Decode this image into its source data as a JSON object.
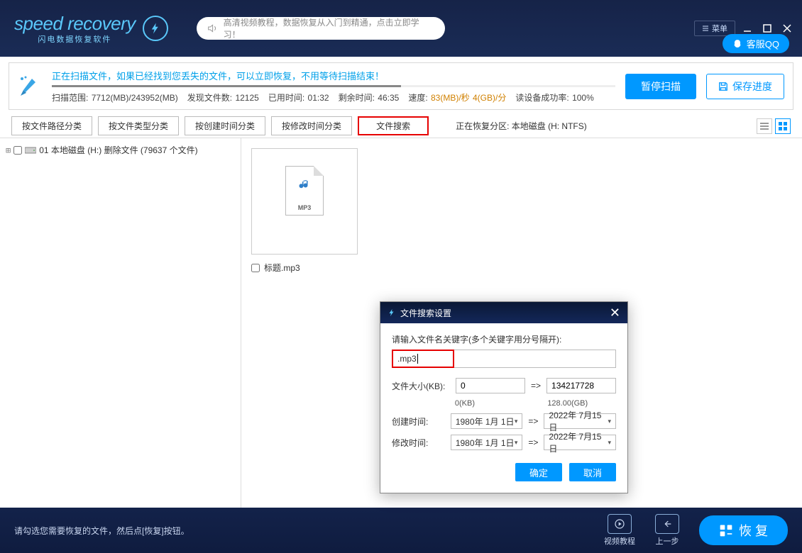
{
  "header": {
    "logo_main": "speed recovery",
    "logo_sub": "闪电数据恢复软件",
    "tutorial": "高清视频教程，数据恢复从入门到精通，点击立即学习！",
    "menu": "菜单",
    "qq": "客服QQ"
  },
  "scan": {
    "status_line": "正在扫描文件，如果已经找到您丢失的文件，可以立即恢复，不用等待扫描结束！",
    "range_label": "扫描范围:",
    "range_value": "7712(MB)/243952(MB)",
    "found_label": "发现文件数:",
    "found_value": "12125",
    "elapsed_label": "已用时间:",
    "elapsed_value": "01:32",
    "remain_label": "剩余时间:",
    "remain_value": "46:35",
    "speed_label": "速度:",
    "speed_value": "83(MB)/秒  4(GB)/分",
    "success_label": "读设备成功率:",
    "success_value": "100%",
    "pause": "暂停扫描",
    "save": "保存进度"
  },
  "tabs": {
    "t1": "按文件路径分类",
    "t2": "按文件类型分类",
    "t3": "按创建时间分类",
    "t4": "按修改时间分类",
    "t5": "文件搜索",
    "partition": "正在恢复分区: 本地磁盘 (H: NTFS)"
  },
  "tree": {
    "item1": "01 本地磁盘 (H:) 删除文件  (79637 个文件)"
  },
  "file": {
    "badge": "MP3",
    "name": "标题.mp3"
  },
  "dialog": {
    "title": "文件搜索设置",
    "kw_label": "请输入文件名关键字(多个关键字用分号隔开):",
    "kw_value": ".mp3",
    "size_label": "文件大小(KB):",
    "size_from": "0",
    "size_to": "134217728",
    "size_from_hint": "0(KB)",
    "size_to_hint": "128.00(GB)",
    "create_label": "创建时间:",
    "modify_label": "修改时间:",
    "date_from": "1980年  1月  1日",
    "date_to": "2022年  7月15日",
    "arrow": "=>",
    "ok": "确定",
    "cancel": "取消"
  },
  "footer": {
    "hint": "请勾选您需要恢复的文件，然后点[恢复]按钮。",
    "video": "视频教程",
    "prev": "上一步",
    "recover": "恢 复"
  }
}
